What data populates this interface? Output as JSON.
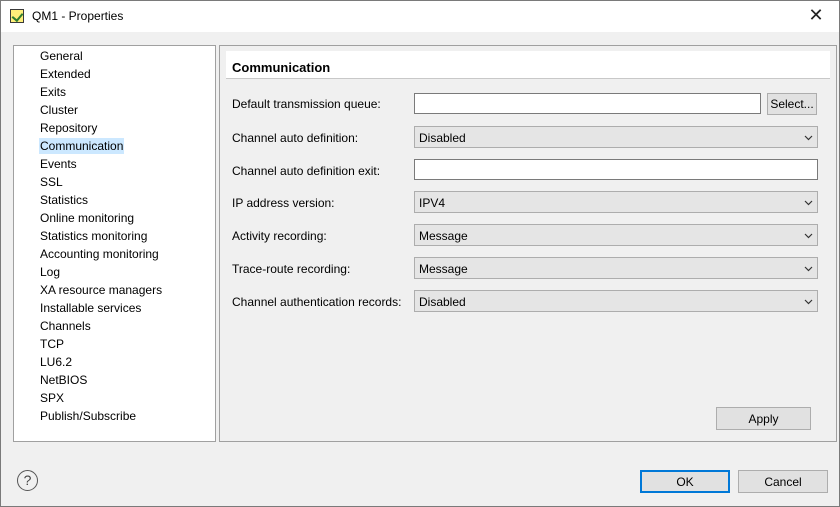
{
  "window": {
    "title": "QM1 - Properties",
    "close_glyph": "✕"
  },
  "nav": {
    "selected": "Communication",
    "items": [
      "General",
      "Extended",
      "Exits",
      "Cluster",
      "Repository",
      "Communication",
      "Events",
      "SSL",
      "Statistics",
      "Online monitoring",
      "Statistics monitoring",
      "Accounting monitoring",
      "Log",
      "XA resource managers",
      "Installable services",
      "Channels",
      "TCP",
      "LU6.2",
      "NetBIOS",
      "SPX",
      "Publish/Subscribe"
    ]
  },
  "panel": {
    "title": "Communication",
    "fields": {
      "default_transmission_queue": {
        "label": "Default transmission queue:",
        "value": ""
      },
      "select_button_label": "Select...",
      "channel_auto_definition": {
        "label": "Channel auto definition:",
        "value": "Disabled"
      },
      "channel_auto_definition_exit": {
        "label": "Channel auto definition exit:",
        "value": ""
      },
      "ip_address_version": {
        "label": "IP address version:",
        "value": "IPV4"
      },
      "activity_recording": {
        "label": "Activity recording:",
        "value": "Message"
      },
      "trace_route_recording": {
        "label": "Trace-route recording:",
        "value": "Message"
      },
      "channel_authentication_records": {
        "label": "Channel authentication records:",
        "value": "Disabled"
      }
    },
    "apply_label": "Apply"
  },
  "footer": {
    "help_glyph": "?",
    "ok_label": "OK",
    "cancel_label": "Cancel"
  },
  "colors": {
    "selection": "#cce8ff",
    "default_button_border": "#0078d7"
  }
}
